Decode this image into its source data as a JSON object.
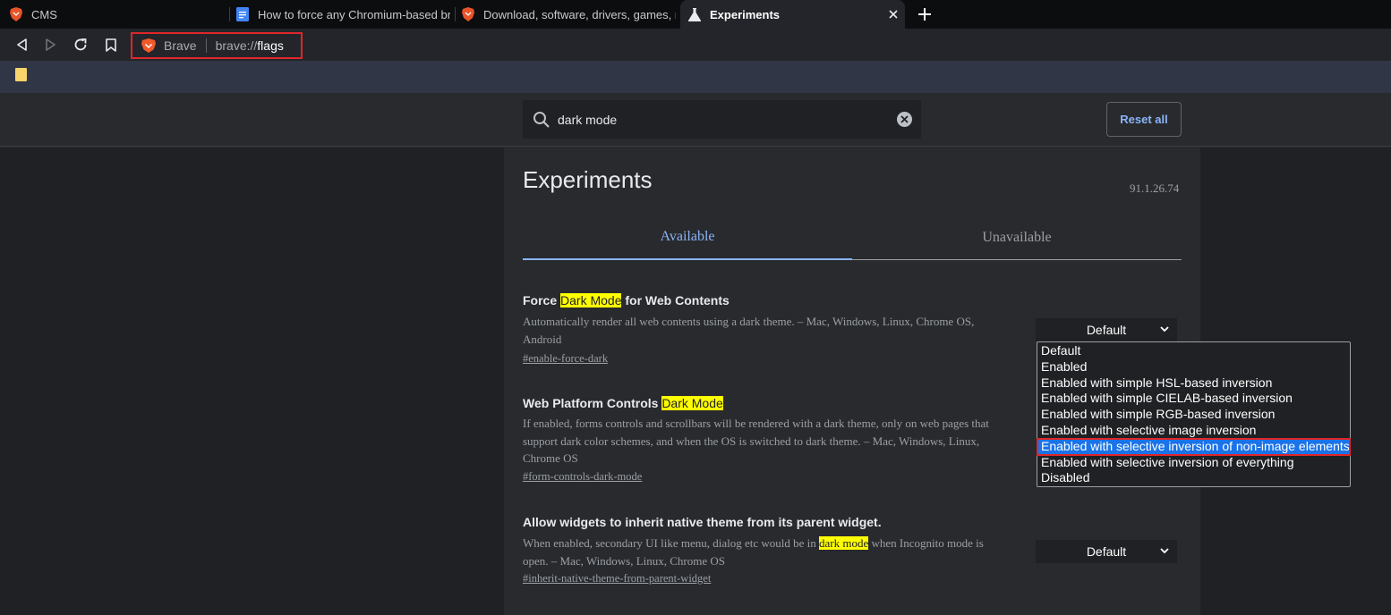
{
  "tabs": [
    {
      "title": "CMS",
      "icon": "brave-lion-icon"
    },
    {
      "title": "How to force any Chromium-based br",
      "icon": "google-docs-icon"
    },
    {
      "title": "Download, software, drivers, games, ne",
      "icon": "brave-lion-icon"
    },
    {
      "title": "Experiments",
      "icon": "flask-icon",
      "active": true
    }
  ],
  "omnibox": {
    "brand": "Brave",
    "scheme": "brave://",
    "host": "flags"
  },
  "search": {
    "value": "dark mode"
  },
  "reset_label": "Reset all",
  "page": {
    "title": "Experiments",
    "version": "91.1.26.74",
    "tab_available": "Available",
    "tab_unavailable": "Unavailable"
  },
  "flags": [
    {
      "name_pre": "Force ",
      "name_hl": "Dark Mode",
      "name_post": " for Web Contents",
      "desc_line1": "Automatically render all web contents using a dark theme. – Mac, Windows, Linux, Chrome OS,",
      "desc_line2": "Android",
      "link": "#enable-force-dark",
      "select_value": "Default"
    },
    {
      "name_pre": "Web Platform Controls ",
      "name_hl": "Dark Mode",
      "name_post": "",
      "desc_line1": "If enabled, forms controls and scrollbars will be rendered with a dark theme, only on web pages that",
      "desc_line2": "support dark color schemes, and when the OS is switched to dark theme. – Mac, Windows, Linux,",
      "desc_line3": "Chrome OS",
      "link": "#form-controls-dark-mode"
    },
    {
      "name": "Allow widgets to inherit native theme from its parent widget.",
      "desc_pre": "When enabled, secondary UI like menu, dialog etc would be in ",
      "desc_hl": "dark mode",
      "desc_post": " when Incognito mode is",
      "desc_line2": "open. – Mac, Windows, Linux, Chrome OS",
      "link": "#inherit-native-theme-from-parent-widget",
      "select_value": "Default"
    }
  ],
  "dropdown_options": [
    "Default",
    "Enabled",
    "Enabled with simple HSL-based inversion",
    "Enabled with simple CIELAB-based inversion",
    "Enabled with simple RGB-based inversion",
    "Enabled with selective image inversion",
    "Enabled with selective inversion of non-image elements",
    "Enabled with selective inversion of everything",
    "Disabled"
  ],
  "dropdown_selected": "Enabled with selective inversion of non-image elements",
  "colors": {
    "highlight": "#ffff00",
    "accent": "#8ab4f8",
    "annotation": "#e0262a",
    "selection": "#1a73e8"
  }
}
